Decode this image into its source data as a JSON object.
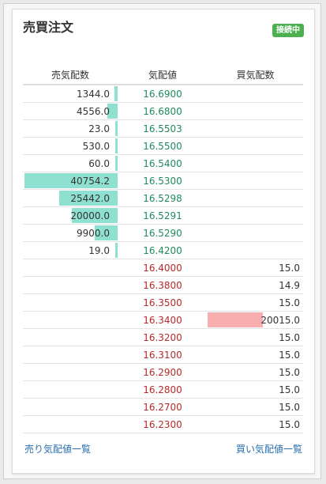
{
  "header": {
    "title": "売買注文",
    "status_badge": "接続中"
  },
  "colors": {
    "ask_bar": "#8ee1d0",
    "bid_bar": "#f8aeae",
    "ask_price": "#1f8a5e",
    "bid_price": "#b52a2a",
    "badge": "#4caf50",
    "link": "#2a6fb0"
  },
  "board": {
    "columns": [
      "売気配数",
      "気配値",
      "買気配数"
    ],
    "max_qty": 40754.2,
    "rows": [
      {
        "ask": "1344.0",
        "ask_qty": 1344.0,
        "price": "16.6900",
        "bid": "",
        "bid_qty": 0
      },
      {
        "ask": "4556.0",
        "ask_qty": 4556.0,
        "price": "16.6800",
        "bid": "",
        "bid_qty": 0
      },
      {
        "ask": "23.0",
        "ask_qty": 23.0,
        "price": "16.5503",
        "bid": "",
        "bid_qty": 0
      },
      {
        "ask": "530.0",
        "ask_qty": 530.0,
        "price": "16.5500",
        "bid": "",
        "bid_qty": 0
      },
      {
        "ask": "60.0",
        "ask_qty": 60.0,
        "price": "16.5400",
        "bid": "",
        "bid_qty": 0
      },
      {
        "ask": "40754.2",
        "ask_qty": 40754.2,
        "price": "16.5300",
        "bid": "",
        "bid_qty": 0
      },
      {
        "ask": "25442.0",
        "ask_qty": 25442.0,
        "price": "16.5298",
        "bid": "",
        "bid_qty": 0
      },
      {
        "ask": "20000.0",
        "ask_qty": 20000.0,
        "price": "16.5291",
        "bid": "",
        "bid_qty": 0
      },
      {
        "ask": "9900.0",
        "ask_qty": 9900.0,
        "price": "16.5290",
        "bid": "",
        "bid_qty": 0
      },
      {
        "ask": "19.0",
        "ask_qty": 19.0,
        "price": "16.4200",
        "bid": "",
        "bid_qty": 0
      },
      {
        "ask": "",
        "ask_qty": 0,
        "price": "16.4000",
        "bid": "15.0",
        "bid_qty": 15.0
      },
      {
        "ask": "",
        "ask_qty": 0,
        "price": "16.3800",
        "bid": "14.9",
        "bid_qty": 14.9
      },
      {
        "ask": "",
        "ask_qty": 0,
        "price": "16.3500",
        "bid": "15.0",
        "bid_qty": 15.0
      },
      {
        "ask": "",
        "ask_qty": 0,
        "price": "16.3400",
        "bid": "20015.0",
        "bid_qty": 20015.0
      },
      {
        "ask": "",
        "ask_qty": 0,
        "price": "16.3200",
        "bid": "15.0",
        "bid_qty": 15.0
      },
      {
        "ask": "",
        "ask_qty": 0,
        "price": "16.3100",
        "bid": "15.0",
        "bid_qty": 15.0
      },
      {
        "ask": "",
        "ask_qty": 0,
        "price": "16.2900",
        "bid": "15.0",
        "bid_qty": 15.0
      },
      {
        "ask": "",
        "ask_qty": 0,
        "price": "16.2800",
        "bid": "15.0",
        "bid_qty": 15.0
      },
      {
        "ask": "",
        "ask_qty": 0,
        "price": "16.2700",
        "bid": "15.0",
        "bid_qty": 15.0
      },
      {
        "ask": "",
        "ask_qty": 0,
        "price": "16.2300",
        "bid": "15.0",
        "bid_qty": 15.0
      }
    ]
  },
  "footer": {
    "sell_link": "売り気配値一覧",
    "buy_link": "買い気配値一覧"
  }
}
